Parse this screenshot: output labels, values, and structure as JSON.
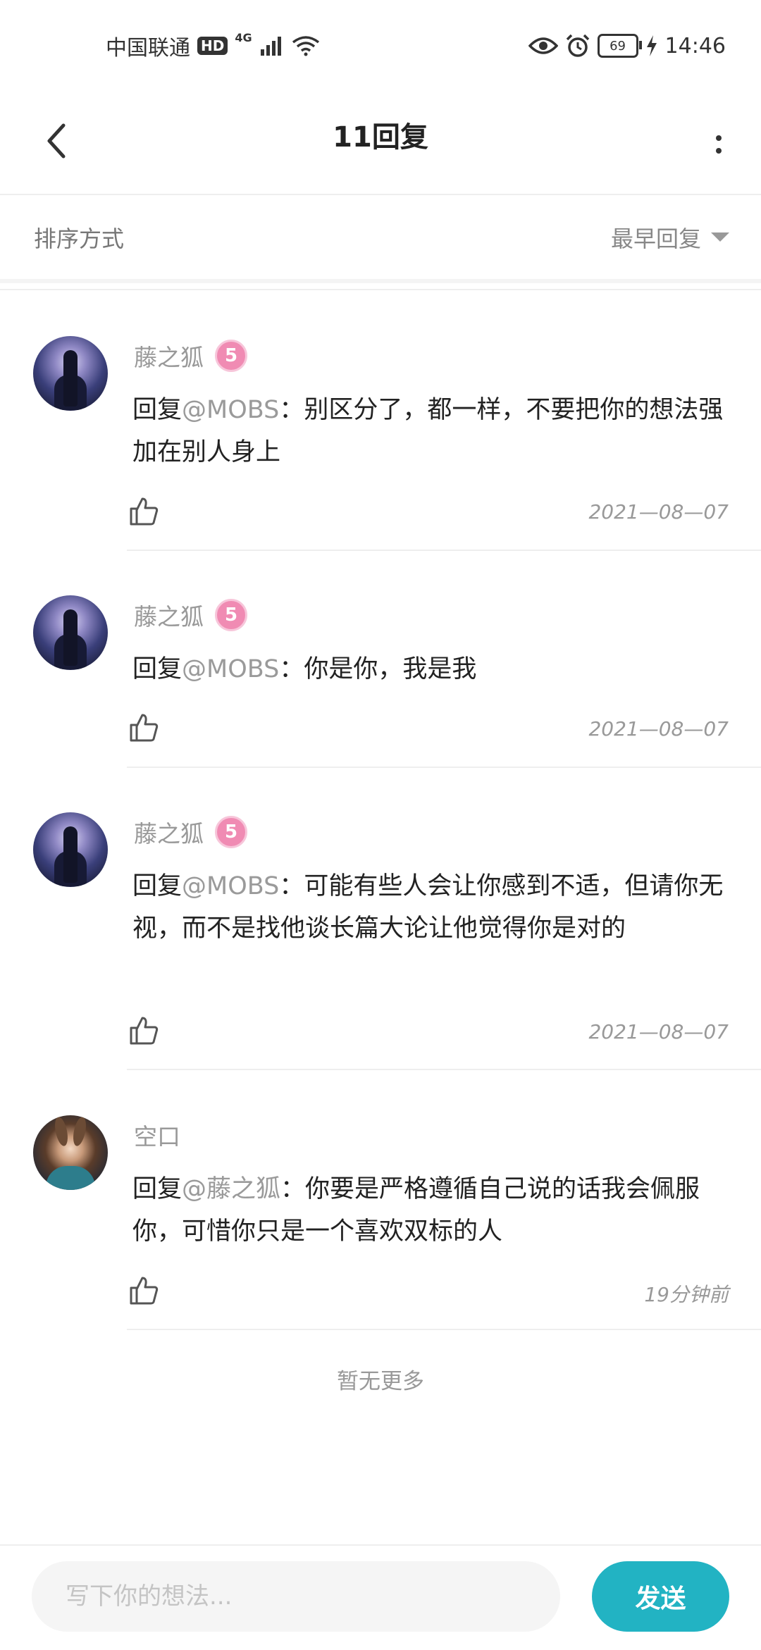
{
  "status_bar": {
    "carrier": "中国联通",
    "hd": "HD",
    "network": "4G",
    "battery": "69",
    "time": "14:46"
  },
  "header": {
    "title": "11回复"
  },
  "sort": {
    "label": "排序方式",
    "selected": "最早回复"
  },
  "comments": [
    {
      "username": "藤之狐",
      "level": "5",
      "reply_prefix": "回复",
      "mention": "@MOBS",
      "text": "：别区分了，都一样，不要把你的想法强加在别人身上",
      "date": "2021—08—07"
    },
    {
      "username": "藤之狐",
      "level": "5",
      "reply_prefix": "回复",
      "mention": "@MOBS",
      "text": "：你是你，我是我",
      "date": "2021—08—07"
    },
    {
      "username": "藤之狐",
      "level": "5",
      "reply_prefix": "回复",
      "mention": "@MOBS",
      "text": "：可能有些人会让你感到不适，但请你无视，而不是找他谈长篇大论让他觉得你是对的",
      "date": "2021—08—07"
    },
    {
      "username": "空口",
      "reply_prefix": "回复",
      "mention": "@藤之狐",
      "text": "：你要是严格遵循自己说的话我会佩服你，可惜你只是一个喜欢双标的人",
      "date": "19分钟前"
    }
  ],
  "footer_note": "暂无更多",
  "composer": {
    "placeholder": "写下你的想法...",
    "send_label": "发送"
  },
  "colors": {
    "accent": "#22b3c3",
    "level_badge": "#f08bb3"
  }
}
